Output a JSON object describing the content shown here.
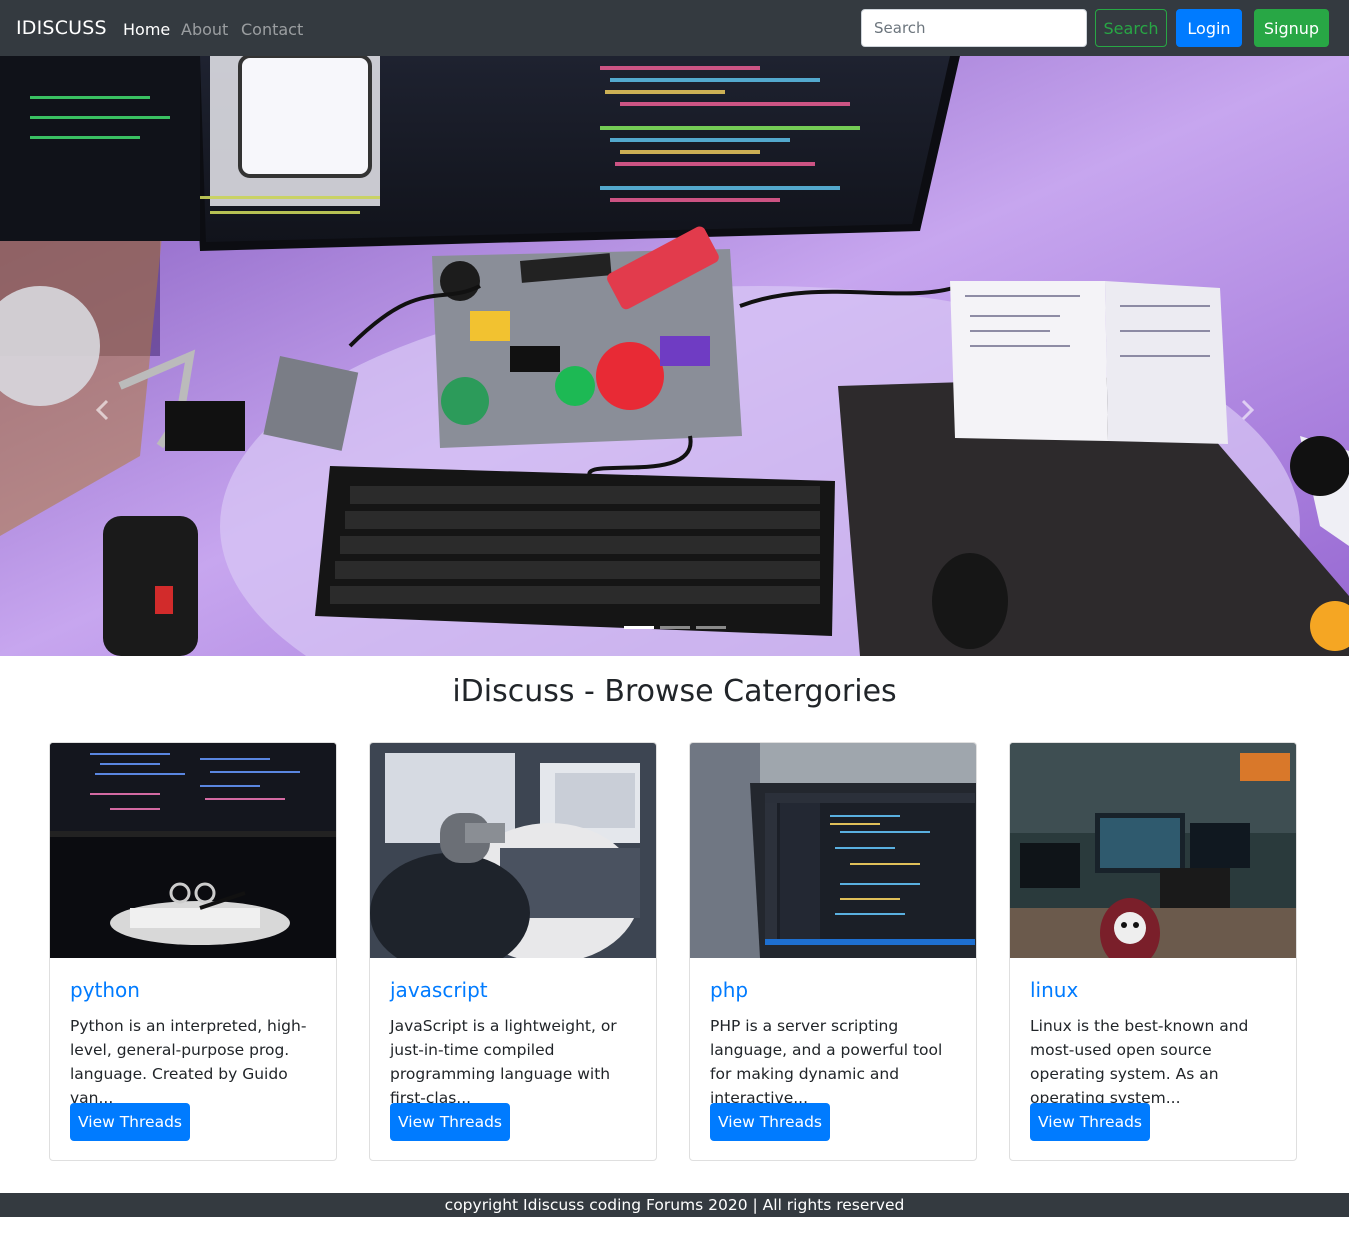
{
  "navbar": {
    "brand": "IDISCUSS",
    "links": [
      {
        "label": "Home",
        "active": true
      },
      {
        "label": "About",
        "active": false
      },
      {
        "label": "Contact",
        "active": false
      }
    ],
    "search_placeholder": "Search",
    "search_button": "Search",
    "login_button": "Login",
    "signup_button": "Signup"
  },
  "carousel": {
    "slide_count": 3,
    "active_slide": 1,
    "prev_icon": "chevron-left-icon",
    "next_icon": "chevron-right-icon"
  },
  "main": {
    "heading": "iDiscuss - Browse Catergories",
    "categories": [
      {
        "title": "python",
        "description": "Python is an interpreted, high-level, general-purpose prog. language. Created by Guido van...",
        "button": "View Threads"
      },
      {
        "title": "javascript",
        "description": "JavaScript is a lightweight, or just-in-time compiled programming language with first-clas...",
        "button": "View Threads"
      },
      {
        "title": "php",
        "description": "PHP is a server scripting language, and a powerful tool for making dynamic and interactive...",
        "button": "View Threads"
      },
      {
        "title": "linux",
        "description": "Linux is the best-known and most-used open source operating system. As an operating system...",
        "button": "View Threads"
      }
    ]
  },
  "footer": {
    "text": "copyright Idiscuss coding Forums 2020 | All rights reserved"
  },
  "colors": {
    "navbar_bg": "#343a40",
    "primary": "#007bff",
    "success": "#28a745",
    "hero_tint": "#b48ae6"
  }
}
